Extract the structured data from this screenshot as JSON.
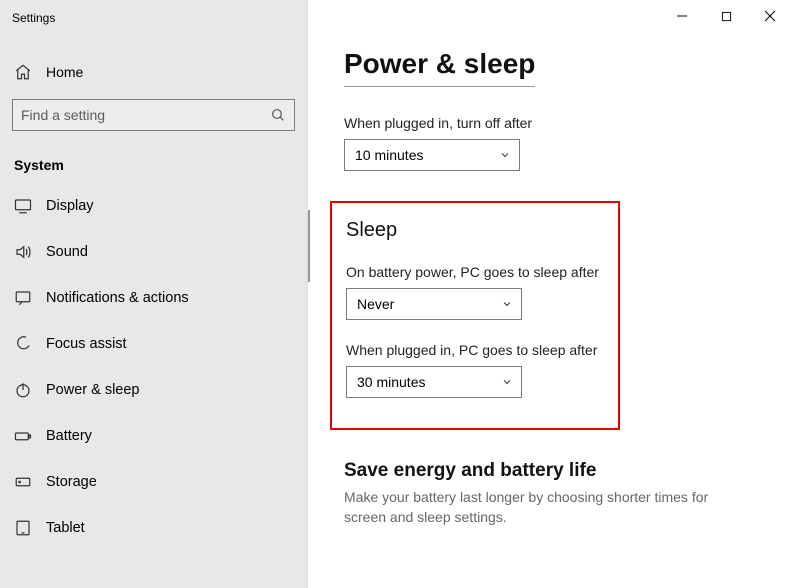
{
  "window": {
    "title": "Settings"
  },
  "sidebar": {
    "home": "Home",
    "search_placeholder": "Find a setting",
    "section": "System",
    "items": [
      {
        "label": "Display"
      },
      {
        "label": "Sound"
      },
      {
        "label": "Notifications & actions"
      },
      {
        "label": "Focus assist"
      },
      {
        "label": "Power & sleep"
      },
      {
        "label": "Battery"
      },
      {
        "label": "Storage"
      },
      {
        "label": "Tablet"
      }
    ]
  },
  "main": {
    "title": "Power & sleep",
    "screen": {
      "label": "When plugged in, turn off after",
      "value": "10 minutes"
    },
    "sleep": {
      "heading": "Sleep",
      "battery": {
        "label": "On battery power, PC goes to sleep after",
        "value": "Never"
      },
      "plugged": {
        "label": "When plugged in, PC goes to sleep after",
        "value": "30 minutes"
      }
    },
    "save": {
      "heading": "Save energy and battery life",
      "sub": "Make your battery last longer by choosing shorter times for screen and sleep settings."
    }
  }
}
